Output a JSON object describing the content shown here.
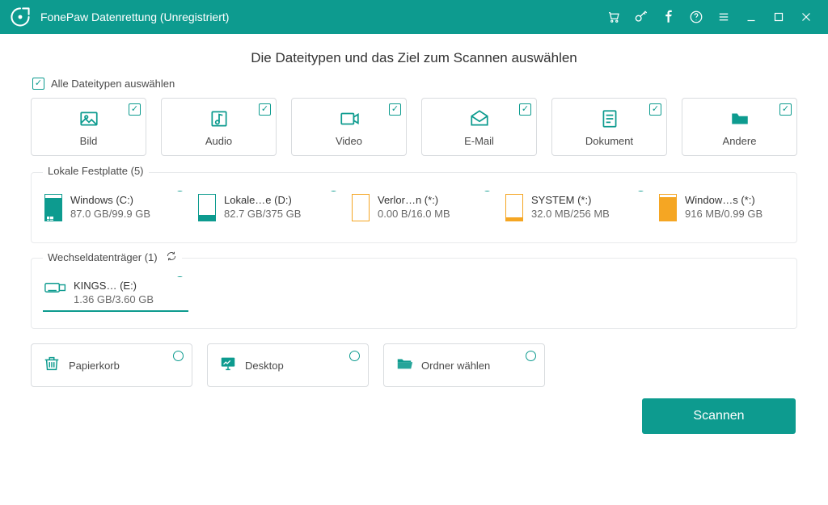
{
  "window": {
    "title": "FonePaw Datenrettung (Unregistriert)"
  },
  "page_title": "Die Dateitypen und das Ziel zum Scannen auswählen",
  "select_all_label": "Alle Dateitypen auswählen",
  "categories": [
    {
      "label": "Bild"
    },
    {
      "label": "Audio"
    },
    {
      "label": "Video"
    },
    {
      "label": "E-Mail"
    },
    {
      "label": "Dokument"
    },
    {
      "label": "Andere"
    }
  ],
  "local_drives": {
    "legend": "Lokale Festplatte (5)",
    "items": [
      {
        "name": "Windows (C:)",
        "size": "87.0 GB/99.9 GB"
      },
      {
        "name": "Lokale…e (D:)",
        "size": "82.7 GB/375 GB"
      },
      {
        "name": "Verlor…n (*:)",
        "size": "0.00  B/16.0 MB"
      },
      {
        "name": "SYSTEM (*:)",
        "size": "32.0 MB/256 MB"
      },
      {
        "name": "Window…s (*:)",
        "size": "916 MB/0.99 GB"
      }
    ]
  },
  "removable": {
    "legend": "Wechseldatenträger (1)",
    "items": [
      {
        "name": "KINGS… (E:)",
        "size": "1.36 GB/3.60 GB"
      }
    ]
  },
  "locations": [
    {
      "label": "Papierkorb"
    },
    {
      "label": "Desktop"
    },
    {
      "label": "Ordner wählen"
    }
  ],
  "scan_label": "Scannen"
}
